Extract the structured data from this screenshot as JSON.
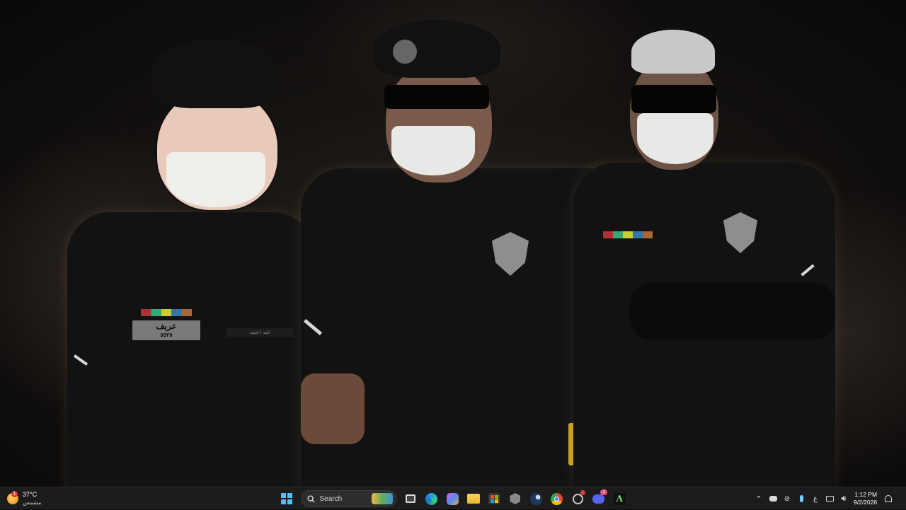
{
  "wallpaper": {
    "name_tag_text": "عريف",
    "name_tag_number": "٥٥٢٥",
    "name_strip_text": "عبد احمد"
  },
  "taskbar": {
    "weather": {
      "icon": "sun-icon",
      "alert_count": "1",
      "temperature": "37°C",
      "condition": "مشمس"
    },
    "start_icon": "windows-icon",
    "search_placeholder": "Search",
    "pinned_apps": [
      {
        "name": "task-view",
        "icon": "task-view-icon"
      },
      {
        "name": "edge",
        "icon": "edge-icon"
      },
      {
        "name": "copilot",
        "icon": "copilot-icon"
      },
      {
        "name": "file-explorer",
        "icon": "folder-icon"
      },
      {
        "name": "microsoft-store",
        "icon": "store-icon"
      },
      {
        "name": "app-hex",
        "icon": "hexagon-icon"
      },
      {
        "name": "steam",
        "icon": "steam-icon"
      },
      {
        "name": "chrome",
        "icon": "chrome-icon"
      },
      {
        "name": "app-badge",
        "icon": "circle-badge-icon"
      },
      {
        "name": "discord",
        "icon": "discord-icon",
        "badge": "2"
      },
      {
        "name": "app-a",
        "icon": "a-logo-icon"
      }
    ],
    "tray": {
      "language": "ع",
      "time": "1:12 PM",
      "date": "9/2/2026"
    }
  }
}
